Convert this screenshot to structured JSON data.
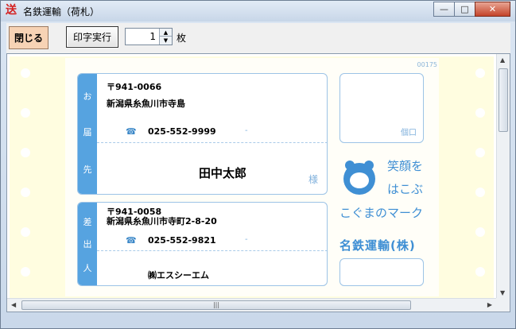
{
  "window": {
    "title": "名鉄運輸（荷札）",
    "app_icon_char": "送",
    "buttons": {
      "minimize": "—",
      "maximize": "□",
      "close": "✕"
    }
  },
  "toolbar": {
    "close_label": "閉じる",
    "print_label": "印字実行",
    "copies_value": "1",
    "copies_unit": "枚"
  },
  "label": {
    "tracking_no": "00175",
    "recipient": {
      "tab_chars": [
        "お",
        "届",
        "先"
      ],
      "postal": "〒941-0066",
      "address": "新潟県糸魚川市寺島",
      "phone_icon": "☎",
      "phone": "025-552-9999",
      "dash": "-",
      "name": "田中太郎",
      "honorific": "様"
    },
    "sender": {
      "tab_chars": [
        "差",
        "出",
        "人"
      ],
      "postal": "〒941-0058",
      "address": "新潟県糸魚川市寺町2-8-20",
      "phone_icon": "☎",
      "phone": "025-552-9821",
      "dash": "-",
      "name": "㈱エスシーエム"
    },
    "side": {
      "box_label": "個口",
      "slogan_line1": "笑顔を",
      "slogan_line2": "はこぶ",
      "slogan_line3": "こぐまのマーク",
      "company": "名鉄運輸(株)"
    }
  },
  "colors": {
    "accent_blue": "#56a3e0",
    "paper": "#fffde0",
    "close_btn": "#f7d3b5"
  },
  "icons": [
    "app-icon",
    "phone-icon",
    "bear-logo-icon",
    "spin-up-icon",
    "spin-down-icon",
    "scroll-arrow-icon"
  ]
}
